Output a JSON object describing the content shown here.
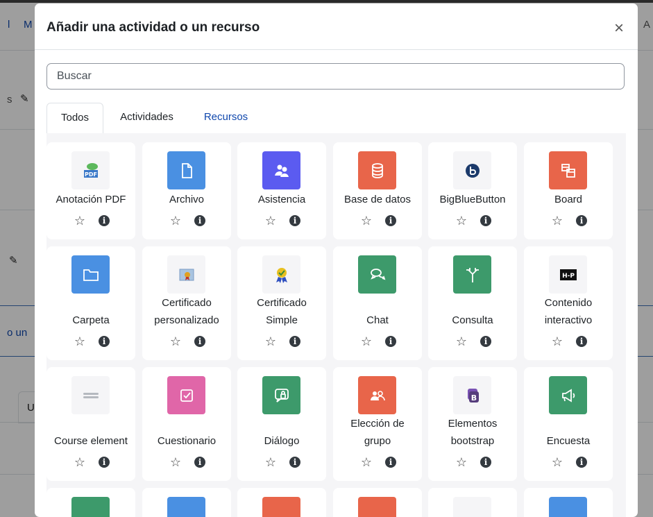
{
  "background": {
    "nav_fragment_1": "l",
    "nav_fragment_2": "M",
    "nav_fragment_3": "A",
    "edit_text": "s",
    "link_text": "o un",
    "tab_fragment": "U"
  },
  "modal": {
    "title": "Añadir una actividad o un recurso",
    "close_symbol": "×",
    "search_placeholder": "Buscar",
    "tabs": [
      {
        "label": "Todos"
      },
      {
        "label": "Actividades"
      },
      {
        "label": "Recursos"
      }
    ],
    "star_symbol": "☆",
    "info_symbol": "i",
    "items": [
      {
        "name": "Anotación PDF",
        "icon": "pdf-annotation-icon",
        "color": "#f5f5f7"
      },
      {
        "name": "Archivo",
        "icon": "file-icon",
        "color": "#4a90e2"
      },
      {
        "name": "Asistencia",
        "icon": "attendance-icon",
        "color": "#5b5bf0"
      },
      {
        "name": "Base de datos",
        "icon": "database-icon",
        "color": "#e8654a"
      },
      {
        "name": "BigBlueButton",
        "icon": "bigbluebutton-icon",
        "color": "#f5f5f7"
      },
      {
        "name": "Board",
        "icon": "board-icon",
        "color": "#e8654a"
      },
      {
        "name": "Carpeta",
        "icon": "folder-icon",
        "color": "#4a90e2"
      },
      {
        "name": "Certificado personalizado",
        "line1": "Certificado",
        "line2": "personalizado",
        "icon": "custom-certificate-icon",
        "color": "#f5f5f7"
      },
      {
        "name": "Certificado Simple",
        "line1": "Certificado",
        "line2": "Simple",
        "icon": "simple-certificate-icon",
        "color": "#f5f5f7"
      },
      {
        "name": "Chat",
        "icon": "chat-icon",
        "color": "#3d9a6b"
      },
      {
        "name": "Consulta",
        "icon": "choice-icon",
        "color": "#3d9a6b"
      },
      {
        "name": "Contenido interactivo",
        "line1": "Contenido",
        "line2": "interactivo",
        "icon": "h5p-icon",
        "color": "#f5f5f7"
      },
      {
        "name": "Course element",
        "icon": "course-element-icon",
        "color": "#f5f5f7"
      },
      {
        "name": "Cuestionario",
        "icon": "quiz-icon",
        "color": "#e066a8"
      },
      {
        "name": "Diálogo",
        "icon": "dialogue-icon",
        "color": "#3d9a6b"
      },
      {
        "name": "Elección de grupo",
        "line1": "Elección de",
        "line2": "grupo",
        "icon": "group-choice-icon",
        "color": "#e8654a"
      },
      {
        "name": "Elementos bootstrap",
        "line1": "Elementos",
        "line2": "bootstrap",
        "icon": "bootstrap-icon",
        "color": "#f5f5f7"
      },
      {
        "name": "Encuesta",
        "icon": "survey-icon",
        "color": "#3d9a6b"
      }
    ],
    "partial_row_colors": [
      "#3d9a6b",
      "#4a90e2",
      "#e8654a",
      "#e8654a",
      "#f5f5f7",
      "#4a90e2"
    ]
  }
}
